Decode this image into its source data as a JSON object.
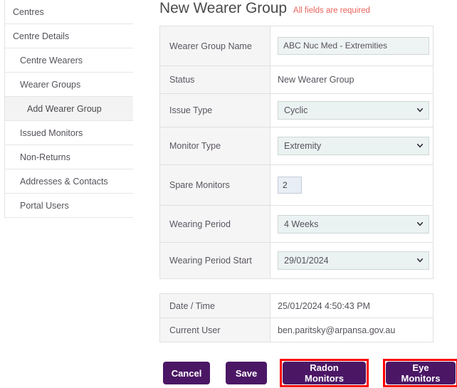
{
  "sidebar": {
    "items": [
      {
        "label": "Centres",
        "level": 0,
        "active": false
      },
      {
        "label": "Centre Details",
        "level": 0,
        "active": false
      },
      {
        "label": "Centre Wearers",
        "level": 1,
        "active": false
      },
      {
        "label": "Wearer Groups",
        "level": 1,
        "active": false
      },
      {
        "label": "Add Wearer Group",
        "level": 2,
        "active": true
      },
      {
        "label": "Issued Monitors",
        "level": 1,
        "active": false
      },
      {
        "label": "Non-Returns",
        "level": 1,
        "active": false
      },
      {
        "label": "Addresses & Contacts",
        "level": 1,
        "active": false
      },
      {
        "label": "Portal Users",
        "level": 1,
        "active": false
      }
    ]
  },
  "header": {
    "title": "New Wearer Group",
    "required_note": "All fields are required"
  },
  "form": {
    "rows": [
      {
        "label": "Wearer Group Name",
        "value": "ABC Nuc Med - Extremities",
        "control": "text"
      },
      {
        "label": "Status",
        "value": "New Wearer Group",
        "control": "static"
      },
      {
        "label": "Issue Type",
        "value": "Cyclic",
        "control": "select"
      },
      {
        "label": "Monitor Type",
        "value": "Extremity",
        "control": "select"
      },
      {
        "label": "Spare Monitors",
        "value": "2",
        "control": "number"
      },
      {
        "label": "Wearing Period",
        "value": "4 Weeks",
        "control": "select"
      },
      {
        "label": "Wearing Period Start",
        "value": "29/01/2024",
        "control": "select"
      }
    ]
  },
  "info": {
    "rows": [
      {
        "label": "Date / Time",
        "value": "25/01/2024 4:50:43 PM"
      },
      {
        "label": "Current User",
        "value": "ben.paritsky@arpansa.gov.au"
      }
    ]
  },
  "buttons": {
    "cancel": "Cancel",
    "save": "Save",
    "radon_monitors": "Radon Monitors",
    "eye_monitors": "Eye Monitors"
  },
  "colors": {
    "brand_purple": "#4b1765",
    "required_red": "#e8645b",
    "highlight_red": "#fe0000",
    "input_bg": "#eaf2f2",
    "label_bg": "#f5f5f5"
  }
}
